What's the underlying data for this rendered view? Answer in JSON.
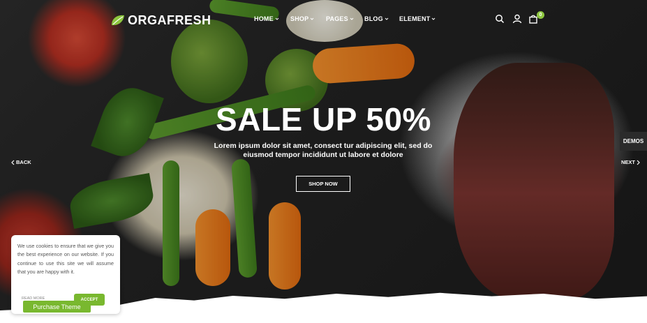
{
  "header": {
    "logo_text": "ORGAFRESH",
    "nav": [
      {
        "label": "HOME"
      },
      {
        "label": "SHOP"
      },
      {
        "label": "PAGES"
      },
      {
        "label": "BLOG"
      },
      {
        "label": "ELEMENT"
      }
    ],
    "icons": [
      "search-icon",
      "user-icon",
      "shopping-bag-icon"
    ],
    "cart_count": "0"
  },
  "hero": {
    "title": "SALE UP 50%",
    "subtitle": "Lorem ipsum dolor sit amet, consect tur adipiscing elit, sed do eiusmod tempor incididunt ut labore et dolore",
    "button_label": "SHOP NOW",
    "prev_label": "BACK",
    "next_label": "NEXT"
  },
  "demos_label": "DEMOS",
  "cookie": {
    "text": "We use cookies to ensure that we give you the best experience on our website. If you continue to use this site we will assume that you are happy with it.",
    "read_more_label": "READ MORE",
    "accept_label": "ACCEPT"
  },
  "purchase_label": "Purchase Theme",
  "colors": {
    "brand_green": "#79b82f",
    "dark_bg": "#232323",
    "badge_green": "#8dc63f"
  }
}
